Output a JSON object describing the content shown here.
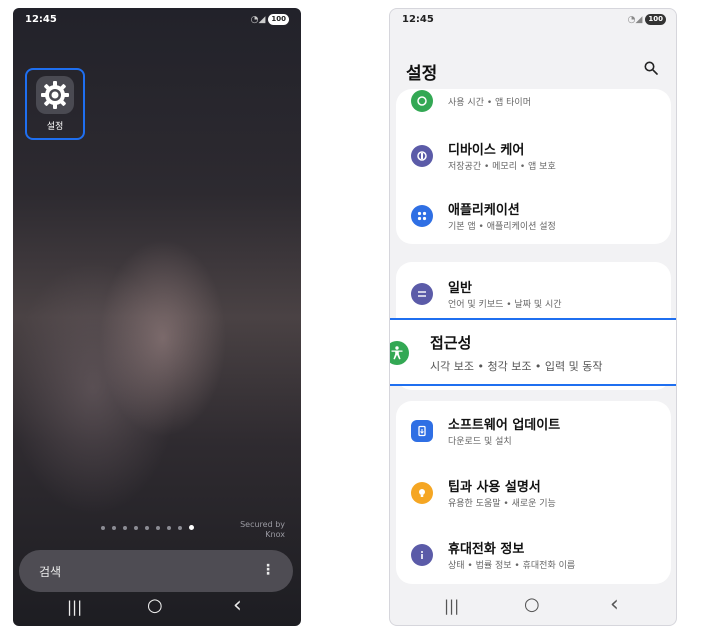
{
  "home": {
    "time": "12:45",
    "battery": "100",
    "app_label": "설정",
    "page_count": 9,
    "knox_line1": "Secured by",
    "knox_line2": "Knox",
    "search_label": "검색",
    "more_glyph": "⋮",
    "nav": {
      "recent": "|||",
      "home": "○",
      "back": "‹"
    }
  },
  "settings": {
    "time": "12:45",
    "battery": "100",
    "title": "설정",
    "items": [
      {
        "title": "",
        "subtitle": "사용 시간 • 앱 타이머",
        "icon": "digital-wellbeing-icon",
        "color": "#33a854"
      },
      {
        "title": "디바이스 케어",
        "subtitle": "저장공간 • 메모리 • 앱 보호",
        "icon": "device-care-icon",
        "color": "#5b5ba8"
      },
      {
        "title": "애플리케이션",
        "subtitle": "기본 앱 • 애플리케이션 설정",
        "icon": "apps-icon",
        "color": "#2f6fe4"
      },
      {
        "title": "일반",
        "subtitle": "언어 및 키보드 • 날짜 및 시간",
        "icon": "general-icon",
        "color": "#5b5ba8"
      },
      {
        "title": "접근성",
        "subtitle": "시각 보조 • 청각 보조 • 입력 및 동작",
        "icon": "accessibility-icon",
        "color": "#33a854"
      },
      {
        "title": "소프트웨어 업데이트",
        "subtitle": "다운로드 및 설치",
        "icon": "software-update-icon",
        "color": "#2f6fe4"
      },
      {
        "title": "팁과 사용 설명서",
        "subtitle": "유용한 도움말 • 새로운 기능",
        "icon": "tips-icon",
        "color": "#f5a623"
      },
      {
        "title": "휴대전화 정보",
        "subtitle": "상태 • 법률 정보 • 휴대전화 이름",
        "icon": "phone-info-icon",
        "color": "#5b5ba8"
      }
    ],
    "nav": {
      "recent": "|||",
      "home": "○",
      "back": "‹"
    }
  },
  "colors": {
    "highlight_border": "#1f6ff0",
    "accent_green": "#33a854",
    "accent_blue": "#2f6fe4",
    "accent_purple": "#5b5ba8",
    "accent_yellow": "#f5a623"
  }
}
